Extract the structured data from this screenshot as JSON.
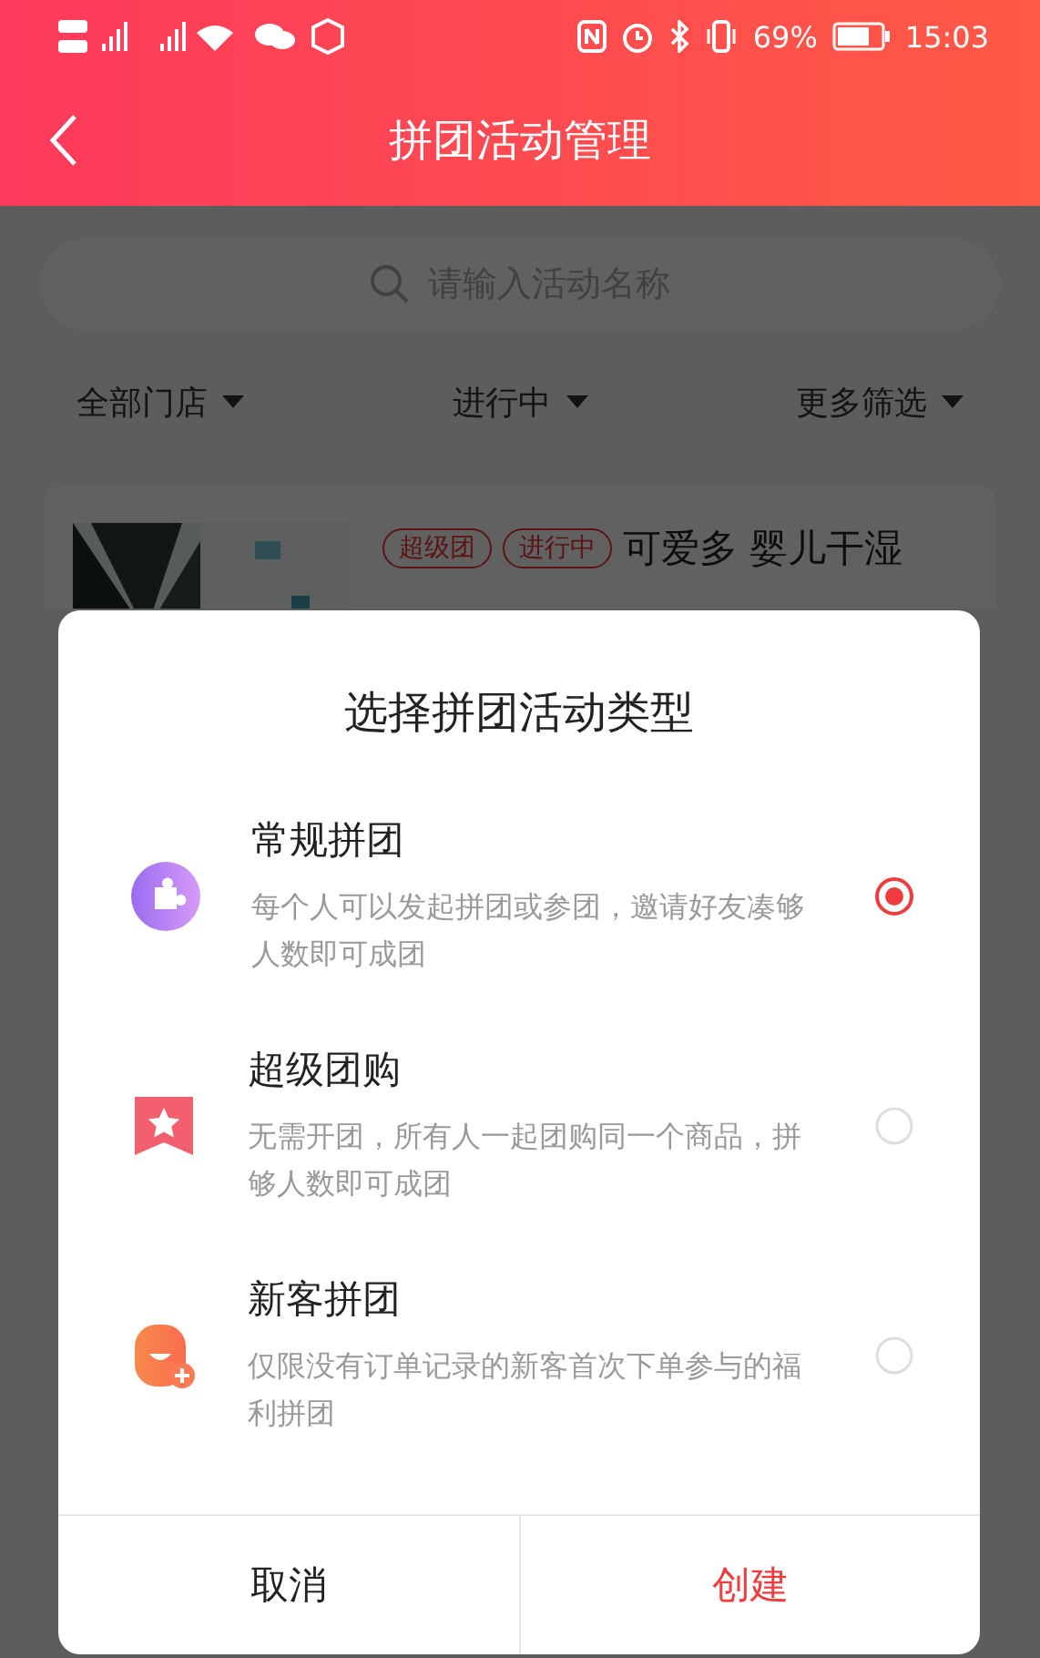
{
  "status_bar": {
    "battery": "69%",
    "time": "15:03"
  },
  "header": {
    "title": "拼团活动管理"
  },
  "search": {
    "placeholder": "请输入活动名称"
  },
  "filters": [
    {
      "label": "全部门店"
    },
    {
      "label": "进行中"
    },
    {
      "label": "更多筛选"
    }
  ],
  "activity_card": {
    "image": {
      "kind": "picture"
    },
    "tags": [
      "超级团",
      "进行中"
    ],
    "title": "可爱多 婴儿干湿"
  },
  "dialog": {
    "title": "选择拼团活动类型",
    "options": [
      {
        "kind": "puzzle",
        "name": "常规拼团",
        "description": "每个人可以发起拼团或参团，邀请好友凑够人数即可成团",
        "selected": true
      },
      {
        "kind": "star",
        "name": "超级团购",
        "description": "无需开团，所有人一起团购同一个商品，拼够人数即可成团",
        "selected": false
      },
      {
        "kind": "newuser",
        "name": "新客拼团",
        "description": "仅限没有订单记录的新客首次下单参与的福利拼团",
        "selected": false
      }
    ],
    "buttons": [
      {
        "label": "取消",
        "kind": "cancel"
      },
      {
        "label": "创建",
        "kind": "primary"
      }
    ]
  }
}
